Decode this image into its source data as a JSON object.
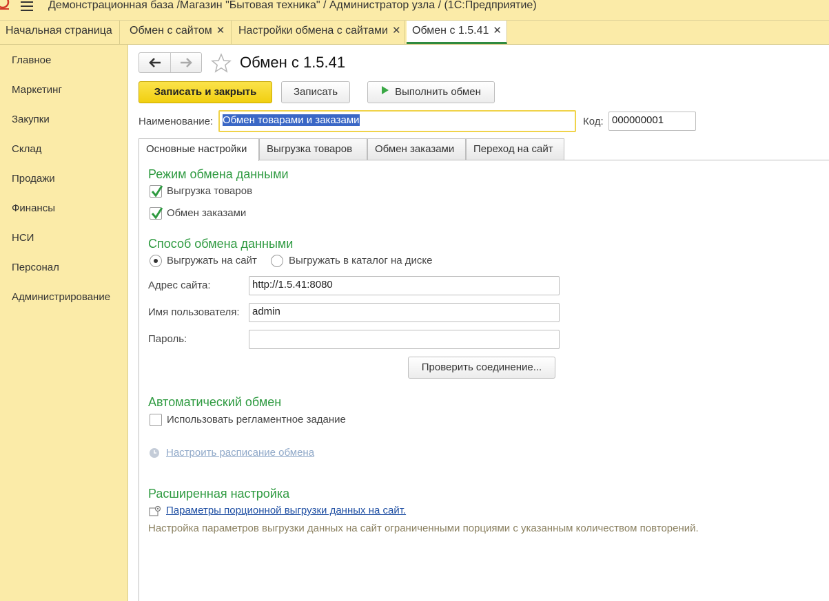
{
  "titlebar": {
    "title": "Демонстрационная база /Магазин \"Бытовая техника\" / Администратор узла /  (1С:Предприятие)"
  },
  "window_tabs": [
    {
      "label": "Начальная страница",
      "closable": false
    },
    {
      "label": "Обмен с сайтом",
      "closable": true
    },
    {
      "label": "Настройки обмена с сайтами",
      "closable": true
    },
    {
      "label": "Обмен с 1.5.41",
      "closable": true,
      "active": true
    }
  ],
  "close_glyph": "✕",
  "sidebar": {
    "items": [
      {
        "label": "Главное"
      },
      {
        "label": "Маркетинг"
      },
      {
        "label": "Закупки"
      },
      {
        "label": "Склад"
      },
      {
        "label": "Продажи"
      },
      {
        "label": "Финансы"
      },
      {
        "label": "НСИ"
      },
      {
        "label": "Персонал"
      },
      {
        "label": "Администрирование"
      }
    ]
  },
  "form": {
    "title": "Обмен с 1.5.41",
    "toolbar": {
      "save_close_label": "Записать и закрыть",
      "save_label": "Записать",
      "run_exchange_label": "Выполнить обмен"
    },
    "name_label": "Наименование:",
    "name_value": "Обмен товарами и заказами",
    "code_label": "Код:",
    "code_value": "000000001",
    "tabs": [
      {
        "label": "Основные настройки",
        "active": true
      },
      {
        "label": "Выгрузка товаров"
      },
      {
        "label": "Обмен заказами"
      },
      {
        "label": "Переход на сайт"
      }
    ],
    "mode_section": {
      "title": "Режим обмена данными",
      "export_goods": {
        "label": "Выгрузка товаров",
        "checked": true
      },
      "exchange_orders": {
        "label": "Обмен заказами",
        "checked": true
      }
    },
    "method_section": {
      "title": "Способ обмена данными",
      "radio_site": {
        "label": "Выгружать на сайт",
        "selected": true
      },
      "radio_disk": {
        "label": "Выгружать в каталог на диске",
        "selected": false
      },
      "site_address_label": "Адрес сайта:",
      "site_address_value": "http://1.5.41:8080",
      "username_label": "Имя пользователя:",
      "username_value": "admin",
      "password_label": "Пароль:",
      "password_value": "",
      "check_connection_label": "Проверить соединение..."
    },
    "auto_section": {
      "title": "Автоматический обмен",
      "use_scheduled": {
        "label": "Использовать регламентное задание",
        "checked": false
      },
      "schedule_link": "Настроить расписание обмена"
    },
    "advanced_section": {
      "title": "Расширенная настройка",
      "batch_link": "Параметры порционной выгрузки данных на сайт.",
      "note": "Настройка параметров выгрузки данных на сайт ограниченными порциями с указанным количеством повторений."
    }
  },
  "colors": {
    "panel_yellow": "#fbeba8",
    "accent_green": "#2e9a40",
    "primary_button": "#f1cf10",
    "link_blue": "#1f4fa3"
  }
}
